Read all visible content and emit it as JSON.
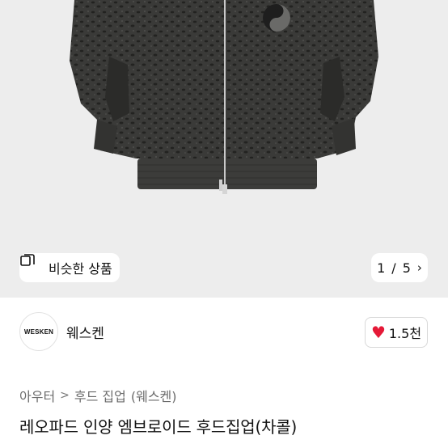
{
  "gallery": {
    "similar_label": "비슷한 상품",
    "current_page": "1",
    "divider": "/",
    "total_pages": "5"
  },
  "brand": {
    "logo_text": "WESKEN",
    "name": "웨스켄",
    "like_count": "1.5천"
  },
  "breadcrumb": {
    "category": "아우터",
    "subcategory": "후드 집업",
    "brand_suffix": "(웨스켄)"
  },
  "product": {
    "title": "레오파드 인양 엠브로이드 후드집업(차콜)"
  },
  "colors": {
    "background": "#ededed",
    "jacket": "#3c3c3a",
    "heart": "#e51937"
  }
}
